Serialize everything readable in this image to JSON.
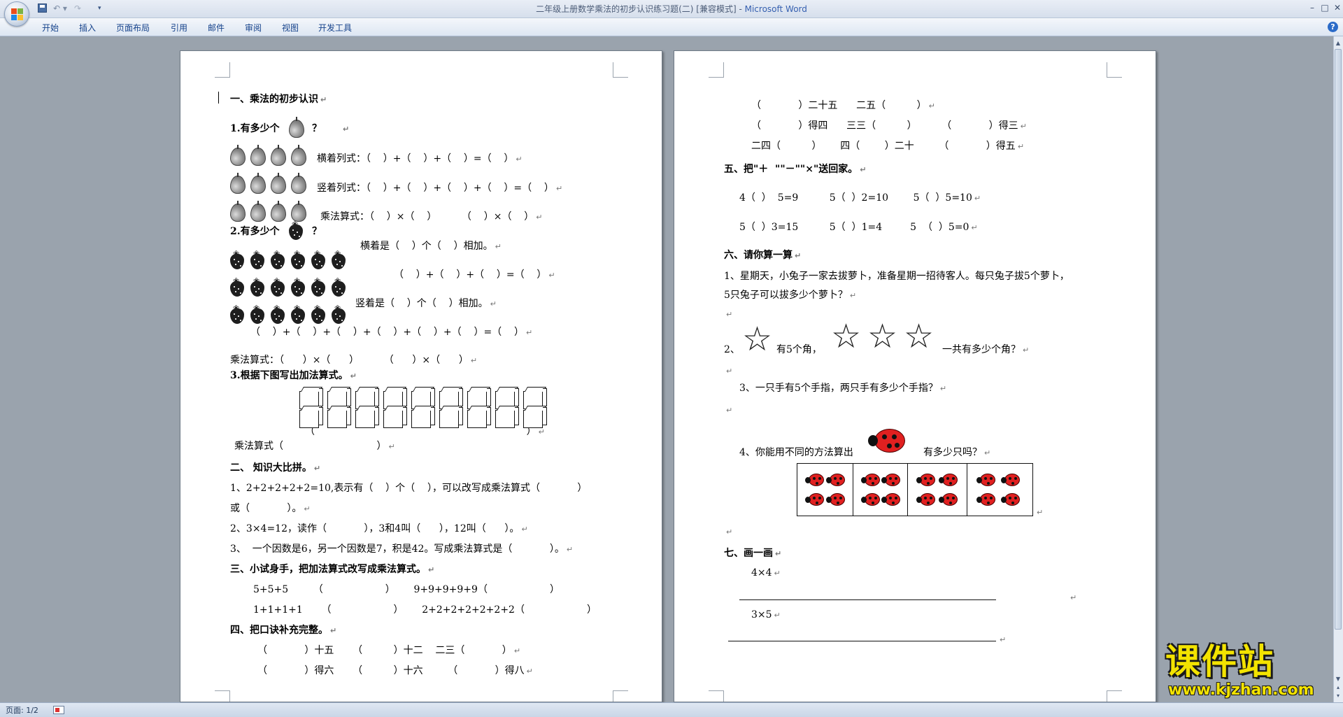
{
  "window": {
    "title_doc": "二年级上册数学乘法的初步认识练习题(二) [兼容模式] - ",
    "title_app": "Microsoft Word",
    "qat_undo": "↶ ▾",
    "qat_redo": "↷",
    "qat_more": "▾",
    "min": "–",
    "max": "□",
    "close": "✕"
  },
  "ribbon": {
    "tabs": [
      "开始",
      "插入",
      "页面布局",
      "引用",
      "邮件",
      "审阅",
      "视图",
      "开发工具"
    ],
    "help": "?"
  },
  "page1": {
    "lines": [
      "一、乘法的初步认识",
      "1.有多少个",
      "？",
      "横着列式：（    ）+（    ）+（    ）=（    ）",
      "竖着列式：（    ）+（    ）+（    ）+（    ）=（    ）",
      "乘法算式：（    ）×（    ）        （    ）×（    ）",
      "2.有多少个",
      "？",
      "横着是（    ）个（    ）相加。",
      "（    ）+（    ）+（    ）=（    ）",
      "竖着是（    ）个（    ）相加。",
      "（    ）+（    ）+（    ）+（    ）+（    ）+（    ）=（    ）",
      "乘法算式：（      ）×（      ）        （      ）×（      ）",
      "3.根据下图写出加法算式。",
      "（                                                                    ）",
      "乘法算式（                              ）",
      "二、 知识大比拼。",
      "1、2+2+2+2+2=10,表示有（    ）个（    ），可以改写成乘法算式（            ）",
      "或（            ）。",
      "2、3×4=12，读作（            ），3和4叫（      ），12叫（      ）。",
      "3、  一个因数是6，另一个因数是7，积是42。写成乘法算式是（            ）。",
      "三、小试身手，把加法算式改写成乘法算式。",
      "5+5+5        （                    ）      9+9+9+9+9（                    ）",
      "1+1+1+1      （                    ）      2+2+2+2+2+2+2（                    ）",
      "四、把口诀补充完整。",
      "（            ）十五      （          ）十二    二三（            ）",
      "（            ）得六      （          ）十六        （            ）得八"
    ]
  },
  "page2": {
    "lines": [
      "（            ）二十五      二五（          ）",
      "（            ）得四      三三（          ）        （            ）得三",
      "二四（          ）      四（        ）二十        （            ）得五",
      "五、把\"＋  \"\"－\"\"×\"送回家。",
      "4（  ）  5=9          5（  ）2=10        5（  ）5=10",
      "5（  ）3=15          5（  ）1=4         5  （  ）5=0",
      "六、请你算一算",
      "1、星期天，小兔子一家去拔萝卜，准备星期一招待客人。每只兔子拔5个萝卜，",
      "5只兔子可以拔多少个萝卜？",
      "2、",
      "有5个角，",
      "一共有多少个角？",
      "3、一只手有5个手指，两只手有多少个手指？",
      "4、你能用不同的方法算出",
      "有多少只吗？",
      "七、画一画",
      "4×4",
      "3×5"
    ]
  },
  "status": {
    "page": "页面: 1/2"
  },
  "watermark": {
    "title": "课件站",
    "url": "www.kjzhan.com"
  },
  "icons": {
    "pm": "↵",
    "star": "☆",
    "up": "▲",
    "down": "▼",
    "prev": "▴",
    "next": "▾"
  }
}
